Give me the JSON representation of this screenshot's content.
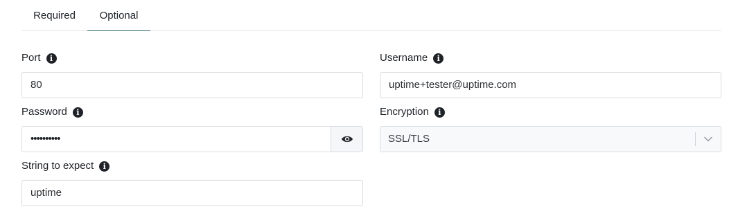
{
  "tabs": {
    "required": "Required",
    "optional": "Optional"
  },
  "fields": {
    "port": {
      "label": "Port",
      "value": "80"
    },
    "username": {
      "label": "Username",
      "value": "uptime+tester@uptime.com"
    },
    "password": {
      "label": "Password",
      "masked_value": "••••••••••"
    },
    "encryption": {
      "label": "Encryption",
      "selected": "SSL/TLS"
    },
    "expect": {
      "label": "String to expect",
      "value": "uptime"
    }
  },
  "icons": {
    "info": "info-icon",
    "eye": "eye-icon",
    "chevron": "chevron-down-icon"
  },
  "colors": {
    "active_tab_underline": "#2d6b68",
    "border": "#d8dbe0",
    "text": "#1f2328"
  }
}
